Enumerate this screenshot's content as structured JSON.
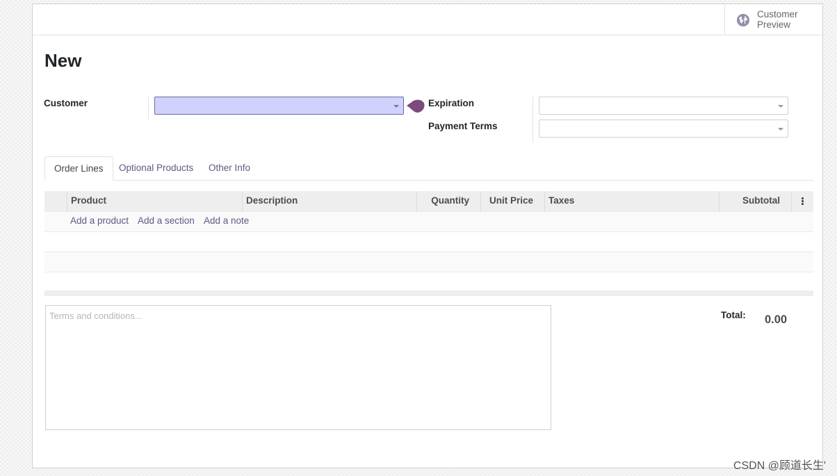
{
  "header": {
    "customer_preview_label": "Customer Preview"
  },
  "form": {
    "title": "New",
    "customer_label": "Customer",
    "customer_value": "",
    "expiration_label": "Expiration",
    "expiration_value": "",
    "payment_terms_label": "Payment Terms",
    "payment_terms_value": ""
  },
  "tabs": [
    {
      "label": "Order Lines",
      "active": true
    },
    {
      "label": "Optional Products",
      "active": false
    },
    {
      "label": "Other Info",
      "active": false
    }
  ],
  "order_lines": {
    "columns": [
      "Product",
      "Description",
      "Quantity",
      "Unit Price",
      "Taxes",
      "Subtotal"
    ],
    "add_product": "Add a product",
    "add_section": "Add a section",
    "add_note": "Add a note"
  },
  "footer": {
    "terms_placeholder": "Terms and conditions...",
    "total_label": "Total:",
    "total_value": "0.00"
  },
  "watermark": "CSDN @顾道长生'",
  "colors": {
    "accent": "#7c4a7c",
    "focused_field": "#d1d1fd",
    "link": "#5b5b82"
  },
  "icons": {
    "preview": "globe-icon",
    "dropdown": "caret-down-icon",
    "grid_options": "kebab-menu-icon"
  }
}
